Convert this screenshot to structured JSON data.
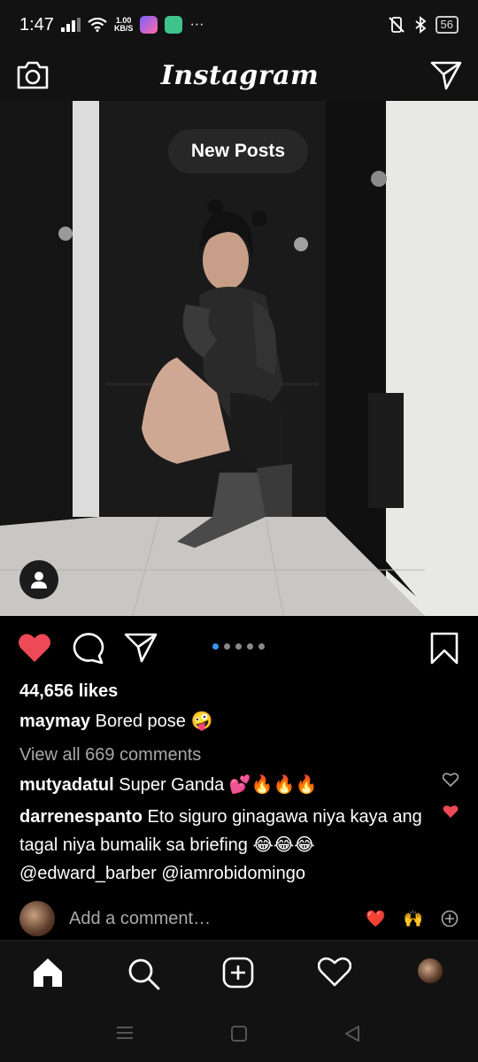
{
  "status": {
    "time": "1:47",
    "net_speed_value": "1.00",
    "net_speed_unit": "KB/S",
    "more": "···",
    "battery": "56"
  },
  "header": {
    "brand": "Instagram"
  },
  "feed": {
    "new_posts_label": "New Posts",
    "likes": "44,656 likes",
    "caption_user": "maymay",
    "caption_text": "Bored pose 🤪",
    "view_all": "View all 669 comments",
    "comments": [
      {
        "user": "mutyadatul",
        "text": "Super Ganda 💕🔥🔥🔥"
      },
      {
        "user": "darrenespanto",
        "text": "Eto siguro ginagawa niya kaya ang tagal niya bumalik sa briefing 😂😂😂 @edward_barber @iamrobidomingo"
      }
    ],
    "add_comment_placeholder": "Add a comment…",
    "quick_reactions": [
      "❤️",
      "🙌"
    ]
  },
  "colors": {
    "like_red": "#ed4956",
    "accent_blue": "#3897f0"
  },
  "icons": [
    "camera-icon",
    "direct-send-icon",
    "heart-icon",
    "comment-icon",
    "share-icon",
    "bookmark-icon",
    "user-tag-icon",
    "home-icon",
    "search-icon",
    "add-post-icon",
    "activity-icon",
    "add-circle-icon"
  ]
}
